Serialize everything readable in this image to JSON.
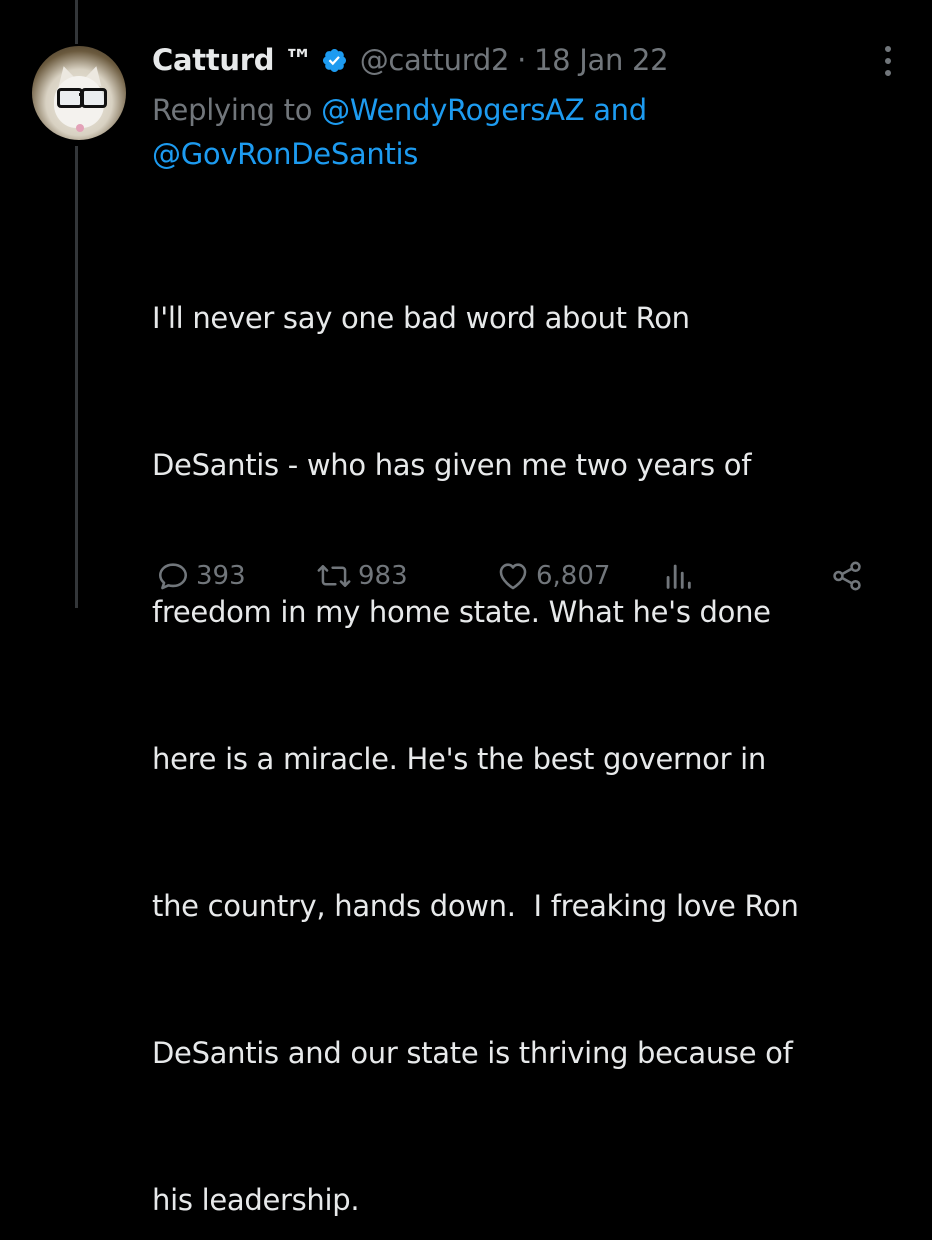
{
  "colors": {
    "background": "#000000",
    "text": "#e7e9ea",
    "muted": "#71767b",
    "accent": "#1d9bf0",
    "thread_line": "#333639"
  },
  "author": {
    "name": "Catturd ™",
    "handle": "@catturd2",
    "date": "18 Jan 22",
    "verified": true,
    "avatar_icon": "cat-with-glasses-avatar"
  },
  "reply": {
    "prefix": "Replying to",
    "mention1": "@WendyRogersAZ",
    "joiner": "and",
    "mention2": "@GovRonDeSantis"
  },
  "tweet": {
    "lines": [
      "I'll never say one bad word about Ron",
      "DeSantis - who has given me two years of",
      "freedom in my home state. What he's done",
      "here is a miracle. He's the best governor in",
      "the country, hands down.  I freaking love Ron",
      "DeSantis and our state is thriving because of",
      "his leadership."
    ]
  },
  "actions": {
    "replies": "393",
    "retweets": "983",
    "likes": "6,807",
    "icons": [
      "reply-icon",
      "retweet-icon",
      "like-icon",
      "views-icon",
      "share-icon"
    ]
  }
}
